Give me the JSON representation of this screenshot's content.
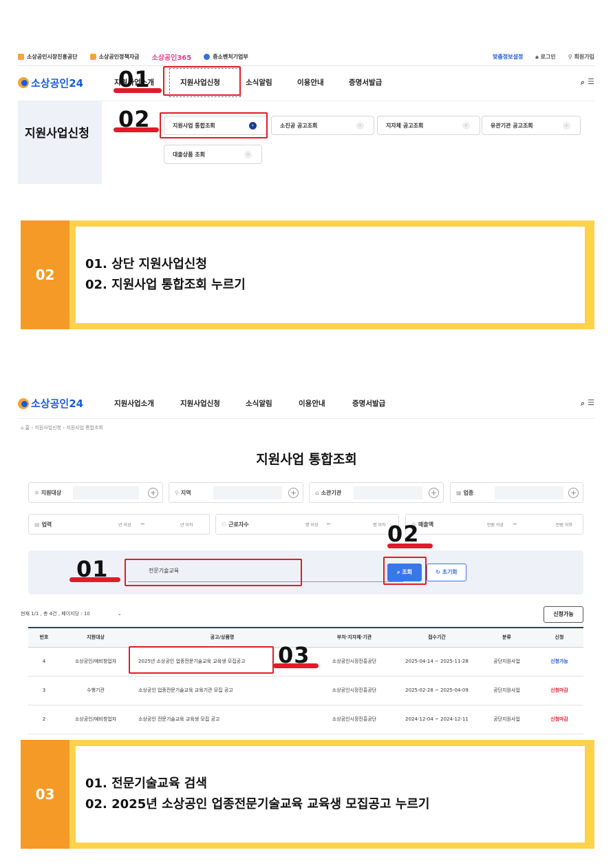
{
  "section1": {
    "topbar": {
      "links": [
        "소상공인시장진흥공단",
        "소상공인정책자금",
        "소상공인365",
        "중소벤처기업부"
      ],
      "right_links": [
        "맞춤정보설정",
        "로그인",
        "회원가입"
      ]
    },
    "logo": "소상공인24",
    "nav": [
      "지원사업소개",
      "지원사업신청",
      "소식알림",
      "이용안내",
      "증명서발급"
    ],
    "side_title": "지원사업신청",
    "sub_buttons": [
      "지원사업 통합조회",
      "소진공 공고조회",
      "지자체 공고조회",
      "유관기관 공고조회",
      "대출상품 조회"
    ],
    "step_labels": [
      "01",
      "02"
    ]
  },
  "band1": {
    "number": "02",
    "lines": [
      "01. 상단 지원사업신청",
      "02. 지원사업 통합조회 누르기"
    ]
  },
  "section2": {
    "logo": "소상공인24",
    "nav": [
      "지원사업소개",
      "지원사업신청",
      "소식알림",
      "이용안내",
      "증명서발급"
    ],
    "breadcrumb": "홈 › 지원사업신청 › 지원사업 통합조회",
    "title": "지원사업 통합조회",
    "filters_row1": [
      "지원대상",
      "지역",
      "소관기관",
      "업종"
    ],
    "filters_row2": {
      "biz_years": "업력",
      "biz_years_min": "년 이상",
      "biz_years_max": "년 이하",
      "workers": "근로자수",
      "workers_min": "명 이상",
      "workers_max": "명 이하",
      "sales": "매출액",
      "sales_min": "만원 이상",
      "sales_max": "만원 이하"
    },
    "search_value": "전문기술교육",
    "search_button": "조회",
    "reset_button": "초기화",
    "meta": "현재 1/1 , 총 4건 , 페이지당 : 10",
    "apply_filter": "신청가능",
    "columns": [
      "번호",
      "지원대상",
      "공고/상품명",
      "부처·지자체·기관",
      "접수기간",
      "분류",
      "신청"
    ],
    "rows": [
      {
        "no": "4",
        "target": "소상공인/예비창업자",
        "title": "2025년 소상공인 업종전문기술교육 교육생 모집공고",
        "org": "소상공인시장진흥공단",
        "period": "2025-04-14 ~ 2025-11-28",
        "cat": "공단지원사업",
        "status": "신청가능"
      },
      {
        "no": "3",
        "target": "수행기관",
        "title": "소상공인 업종전문기술교육 교육기관 모집 공고",
        "org": "소상공인시장진흥공단",
        "period": "2025-02-28 ~ 2025-04-09",
        "cat": "공단지원사업",
        "status": "신청마감"
      },
      {
        "no": "2",
        "target": "소상공인/예비창업자",
        "title": "소상공인 전문기술교육 교육생 모집 공고",
        "org": "소상공인시장진흥공단",
        "period": "2024-12-04 ~ 2024-12-11",
        "cat": "공단지원사업",
        "status": "신청마감"
      }
    ],
    "step_labels": [
      "01",
      "02",
      "03"
    ]
  },
  "band2": {
    "number": "03",
    "lines": [
      "01. 전문기술교육 검색",
      "02. 2025년 소상공인 업종전문기술교육 교육생 모집공고 누르기"
    ]
  },
  "colors": {
    "accent_red": "#e01b2a",
    "band_yellow": "#ffd24a",
    "band_orange": "#f59a26",
    "brand_blue": "#1c5ad9"
  }
}
